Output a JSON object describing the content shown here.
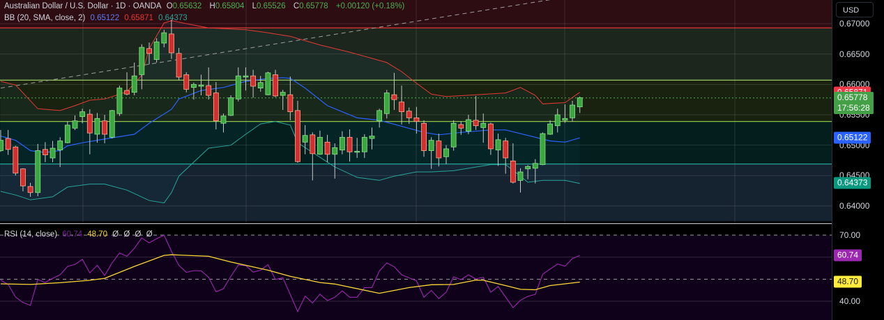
{
  "header": {
    "title": "Australian Dollar / U.S. Dollar · 1D · OANDA",
    "ohlc": [
      {
        "label": "O",
        "value": "0.65632"
      },
      {
        "label": "H",
        "value": "0.65804"
      },
      {
        "label": "L",
        "value": "0.65526"
      },
      {
        "label": "C",
        "value": "0.65778"
      }
    ],
    "change": "+0.00120 (+0.18%)"
  },
  "bb_legend": {
    "name": "BB (20, SMA, close, 2)",
    "basis": "0.65122",
    "upper": "0.65871",
    "lower": "0.64373"
  },
  "rsi_legend": {
    "name": "RSI (14, close)",
    "rsi": "60.74",
    "ma": "48.70",
    "extra": [
      "Ø",
      "Ø",
      "Ø",
      "Ø"
    ]
  },
  "price_axis": {
    "currency": "USD",
    "ticks": [
      "0.67000",
      "0.66500",
      "0.66000",
      "0.65500",
      "0.65000",
      "0.64500",
      "0.64000"
    ],
    "labels": [
      {
        "text": "0.65871",
        "price": 0.65871,
        "color": "#f23645"
      },
      {
        "text": "0.65778",
        "sub": "17:56:28",
        "price": 0.65778,
        "color": "#43a047"
      },
      {
        "text": "0.65122",
        "price": 0.65122,
        "color": "#2962ff"
      },
      {
        "text": "0.64373",
        "price": 0.64373,
        "color": "#089981"
      }
    ]
  },
  "rsi_axis": {
    "ticks": [
      "70.00",
      "40.00"
    ],
    "labels": [
      {
        "text": "60.74",
        "value": 60.74,
        "color": "#9c27b0",
        "fg": "#ffffff"
      },
      {
        "text": "48.70",
        "value": 48.7,
        "color": "#ffeb3b",
        "fg": "#131722"
      }
    ]
  },
  "colors": {
    "up": "#4caf50",
    "down": "#e53935",
    "basis": "#2962ff",
    "upper": "#e53935",
    "lower": "#26a69a",
    "rsi": "#9c27b0",
    "rsi_ma": "#fdd835"
  },
  "chart_data": {
    "type": "candlestick",
    "symbol": "AUDUSD",
    "timeframe": "1D",
    "ylim": [
      0.6375,
      0.6739
    ],
    "ohlc": [
      [
        0.6491,
        0.6525,
        0.6489,
        0.6508
      ],
      [
        0.6511,
        0.6525,
        0.6484,
        0.6493
      ],
      [
        0.6497,
        0.6499,
        0.645,
        0.6454
      ],
      [
        0.6461,
        0.6462,
        0.6424,
        0.6433
      ],
      [
        0.6432,
        0.6438,
        0.6415,
        0.6422
      ],
      [
        0.6422,
        0.6502,
        0.6416,
        0.6491
      ],
      [
        0.6493,
        0.6505,
        0.6472,
        0.6484
      ],
      [
        0.6479,
        0.6507,
        0.6472,
        0.6495
      ],
      [
        0.6492,
        0.6513,
        0.6464,
        0.6507
      ],
      [
        0.6504,
        0.6539,
        0.6503,
        0.6533
      ],
      [
        0.6528,
        0.6549,
        0.6525,
        0.654
      ],
      [
        0.6547,
        0.656,
        0.6536,
        0.6555
      ],
      [
        0.6551,
        0.6559,
        0.6485,
        0.652
      ],
      [
        0.6518,
        0.6553,
        0.6504,
        0.6544
      ],
      [
        0.654,
        0.655,
        0.6503,
        0.6518
      ],
      [
        0.6513,
        0.6558,
        0.6511,
        0.6557
      ],
      [
        0.6552,
        0.6598,
        0.6548,
        0.6594
      ],
      [
        0.659,
        0.662,
        0.6582,
        0.6584
      ],
      [
        0.6587,
        0.6636,
        0.6582,
        0.6614
      ],
      [
        0.6616,
        0.6666,
        0.6592,
        0.6661
      ],
      [
        0.6659,
        0.6669,
        0.6633,
        0.6651
      ],
      [
        0.6641,
        0.6676,
        0.6636,
        0.667
      ],
      [
        0.6668,
        0.669,
        0.6661,
        0.6685
      ],
      [
        0.6683,
        0.6707,
        0.6642,
        0.6652
      ],
      [
        0.6651,
        0.666,
        0.6607,
        0.6612
      ],
      [
        0.6616,
        0.662,
        0.6587,
        0.6592
      ],
      [
        0.6595,
        0.6603,
        0.6575,
        0.66
      ],
      [
        0.6597,
        0.6616,
        0.6582,
        0.6599
      ],
      [
        0.6598,
        0.6628,
        0.6575,
        0.6582
      ],
      [
        0.6586,
        0.6604,
        0.6526,
        0.654
      ],
      [
        0.6536,
        0.6552,
        0.6521,
        0.6548
      ],
      [
        0.6549,
        0.6582,
        0.6548,
        0.6578
      ],
      [
        0.6576,
        0.6628,
        0.6572,
        0.6614
      ],
      [
        0.6612,
        0.6628,
        0.659,
        0.6614
      ],
      [
        0.6614,
        0.6624,
        0.6578,
        0.6597
      ],
      [
        0.6594,
        0.6614,
        0.6588,
        0.6603
      ],
      [
        0.6583,
        0.6621,
        0.6582,
        0.6619
      ],
      [
        0.6616,
        0.6624,
        0.6579,
        0.6581
      ],
      [
        0.6582,
        0.6591,
        0.6558,
        0.6587
      ],
      [
        0.6583,
        0.6613,
        0.6541,
        0.6555
      ],
      [
        0.6557,
        0.6573,
        0.6471,
        0.6473
      ],
      [
        0.6505,
        0.6533,
        0.6485,
        0.6516
      ],
      [
        0.6517,
        0.6521,
        0.6442,
        0.6486
      ],
      [
        0.6485,
        0.6524,
        0.6484,
        0.6513
      ],
      [
        0.6505,
        0.6517,
        0.6472,
        0.6485
      ],
      [
        0.6485,
        0.6503,
        0.6445,
        0.6496
      ],
      [
        0.6492,
        0.6523,
        0.6485,
        0.6513
      ],
      [
        0.6513,
        0.6526,
        0.6473,
        0.6489
      ],
      [
        0.6489,
        0.6512,
        0.6479,
        0.649
      ],
      [
        0.6489,
        0.6518,
        0.6479,
        0.6513
      ],
      [
        0.6511,
        0.6529,
        0.6493,
        0.6515
      ],
      [
        0.654,
        0.656,
        0.6529,
        0.6557
      ],
      [
        0.6552,
        0.6591,
        0.6544,
        0.6586
      ],
      [
        0.6583,
        0.6619,
        0.6558,
        0.6575
      ],
      [
        0.6571,
        0.6598,
        0.6534,
        0.6555
      ],
      [
        0.6556,
        0.6562,
        0.6535,
        0.6545
      ],
      [
        0.6545,
        0.6563,
        0.6519,
        0.6539
      ],
      [
        0.6536,
        0.6541,
        0.6481,
        0.6491
      ],
      [
        0.6491,
        0.6513,
        0.6461,
        0.6508
      ],
      [
        0.6507,
        0.6519,
        0.6465,
        0.6479
      ],
      [
        0.6481,
        0.65,
        0.6469,
        0.6494
      ],
      [
        0.6497,
        0.6541,
        0.6491,
        0.6536
      ],
      [
        0.6534,
        0.6539,
        0.6517,
        0.6528
      ],
      [
        0.6523,
        0.655,
        0.6518,
        0.6542
      ],
      [
        0.6541,
        0.6581,
        0.6525,
        0.6532
      ],
      [
        0.6529,
        0.6552,
        0.6504,
        0.6536
      ],
      [
        0.6535,
        0.6537,
        0.6484,
        0.6494
      ],
      [
        0.6492,
        0.6519,
        0.6466,
        0.6509
      ],
      [
        0.6507,
        0.6512,
        0.6453,
        0.6479
      ],
      [
        0.6474,
        0.6503,
        0.6437,
        0.6439
      ],
      [
        0.6442,
        0.6462,
        0.6422,
        0.6456
      ],
      [
        0.6461,
        0.6467,
        0.6444,
        0.6465
      ],
      [
        0.6462,
        0.6477,
        0.6437,
        0.647
      ],
      [
        0.6468,
        0.6521,
        0.6467,
        0.6519
      ],
      [
        0.6518,
        0.6541,
        0.6517,
        0.6535
      ],
      [
        0.6532,
        0.656,
        0.6521,
        0.655
      ],
      [
        0.6541,
        0.6567,
        0.6537,
        0.6544
      ],
      [
        0.6545,
        0.6573,
        0.6539,
        0.6566
      ],
      [
        0.6563,
        0.658,
        0.6553,
        0.6578
      ]
    ],
    "bb_upper": [
      [
        0,
        0.6605
      ],
      [
        2,
        0.6599
      ],
      [
        5,
        0.656
      ],
      [
        8,
        0.6557
      ],
      [
        10,
        0.6565
      ],
      [
        12,
        0.6574
      ],
      [
        14,
        0.6576
      ],
      [
        17,
        0.6588
      ],
      [
        19,
        0.6615
      ],
      [
        20,
        0.6659
      ],
      [
        22,
        0.6701
      ],
      [
        23,
        0.6705
      ],
      [
        25,
        0.67
      ],
      [
        28,
        0.6693
      ],
      [
        33,
        0.669
      ],
      [
        36,
        0.6685
      ],
      [
        39,
        0.6679
      ],
      [
        43,
        0.6665
      ],
      [
        47,
        0.6653
      ],
      [
        52,
        0.6636
      ],
      [
        54,
        0.6621
      ],
      [
        56,
        0.6602
      ],
      [
        58,
        0.6584
      ],
      [
        60,
        0.658
      ],
      [
        64,
        0.6583
      ],
      [
        68,
        0.6586
      ],
      [
        70,
        0.6595
      ],
      [
        72,
        0.6582
      ],
      [
        73,
        0.6568
      ],
      [
        76,
        0.657
      ],
      [
        78,
        0.6587
      ]
    ],
    "bb_basis": [
      [
        0,
        0.6515
      ],
      [
        2,
        0.6508
      ],
      [
        4,
        0.6491
      ],
      [
        6,
        0.6488
      ],
      [
        8,
        0.6491
      ],
      [
        9,
        0.6499
      ],
      [
        11,
        0.6504
      ],
      [
        14,
        0.651
      ],
      [
        18,
        0.6518
      ],
      [
        20,
        0.6536
      ],
      [
        23,
        0.6559
      ],
      [
        24,
        0.6576
      ],
      [
        27,
        0.659
      ],
      [
        30,
        0.6595
      ],
      [
        33,
        0.6605
      ],
      [
        36,
        0.661
      ],
      [
        38,
        0.6611
      ],
      [
        39,
        0.661
      ],
      [
        41,
        0.6594
      ],
      [
        44,
        0.6565
      ],
      [
        48,
        0.6545
      ],
      [
        51,
        0.6541
      ],
      [
        54,
        0.6531
      ],
      [
        57,
        0.6521
      ],
      [
        59,
        0.6517
      ],
      [
        62,
        0.6521
      ],
      [
        66,
        0.6525
      ],
      [
        68,
        0.6525
      ],
      [
        70,
        0.6519
      ],
      [
        74,
        0.6507
      ],
      [
        76,
        0.6505
      ],
      [
        78,
        0.6512
      ]
    ],
    "bb_lower": [
      [
        0,
        0.6424
      ],
      [
        2,
        0.6418
      ],
      [
        4,
        0.641
      ],
      [
        7,
        0.6415
      ],
      [
        9,
        0.6431
      ],
      [
        12,
        0.6436
      ],
      [
        14,
        0.6436
      ],
      [
        17,
        0.6426
      ],
      [
        20,
        0.6409
      ],
      [
        22,
        0.6405
      ],
      [
        23,
        0.6422
      ],
      [
        24,
        0.6449
      ],
      [
        28,
        0.6495
      ],
      [
        31,
        0.65
      ],
      [
        33,
        0.6518
      ],
      [
        35,
        0.6535
      ],
      [
        37,
        0.6539
      ],
      [
        39,
        0.6533
      ],
      [
        40,
        0.6504
      ],
      [
        45,
        0.6464
      ],
      [
        48,
        0.6447
      ],
      [
        51,
        0.6442
      ],
      [
        53,
        0.6449
      ],
      [
        56,
        0.6456
      ],
      [
        58,
        0.6456
      ],
      [
        61,
        0.6458
      ],
      [
        64,
        0.6464
      ],
      [
        66,
        0.6468
      ],
      [
        68,
        0.6468
      ],
      [
        70,
        0.6449
      ],
      [
        71,
        0.6439
      ],
      [
        73,
        0.6442
      ],
      [
        76,
        0.6442
      ],
      [
        78,
        0.6437
      ]
    ],
    "hlines": [
      {
        "price": 0.6693,
        "color": "#e53935"
      },
      {
        "price": 0.6607,
        "color": "#9ccc65"
      },
      {
        "price": 0.6539,
        "color": "#8bc34a"
      },
      {
        "price": 0.6469,
        "color": "#26a69a"
      }
    ],
    "zones": [
      {
        "from": 0.6739,
        "to": 0.6693,
        "color": "#2d0c12"
      },
      {
        "from": 0.6693,
        "to": 0.6607,
        "color": "#1c261c"
      },
      {
        "from": 0.6607,
        "to": 0.6539,
        "color": "#18220f"
      },
      {
        "from": 0.6539,
        "to": 0.6469,
        "color": "#031e1c"
      },
      {
        "from": 0.6469,
        "to": 0.6375,
        "color": "#15222f"
      }
    ],
    "last_price": 0.65778,
    "trendline": [
      [
        0,
        0.6594
      ],
      [
        86,
        0.6763
      ]
    ],
    "rsi": [
      49.6,
      47.6,
      41.9,
      39.4,
      38.1,
      49.9,
      48.5,
      50.4,
      52.0,
      55.8,
      56.7,
      59.0,
      52.9,
      56.3,
      51.7,
      57.4,
      61.9,
      60.4,
      64.0,
      68.7,
      66.5,
      68.4,
      70.0,
      62.6,
      56.3,
      53.1,
      53.9,
      53.8,
      50.9,
      44.3,
      45.7,
      51.3,
      56.4,
      56.2,
      53.2,
      54.1,
      56.6,
      49.9,
      50.6,
      43.0,
      35.3,
      42.3,
      39.2,
      43.2,
      40.3,
      41.8,
      44.7,
      41.8,
      41.8,
      46.2,
      46.2,
      53.7,
      57.4,
      55.6,
      52.0,
      50.6,
      49.3,
      41.8,
      44.9,
      41.2,
      44.1,
      51.1,
      49.8,
      52.0,
      50.1,
      50.9,
      44.1,
      46.7,
      41.9,
      37.1,
      40.4,
      42.2,
      43.1,
      52.3,
      54.6,
      56.9,
      55.9,
      59.4,
      60.74
    ],
    "rsi_ma": [
      [
        0,
        47.9
      ],
      [
        4,
        47.6
      ],
      [
        8,
        48.4
      ],
      [
        12,
        49.5
      ],
      [
        14,
        50.4
      ],
      [
        18,
        55.8
      ],
      [
        22,
        60.8
      ],
      [
        23,
        61.1
      ],
      [
        28,
        60.4
      ],
      [
        31,
        57.8
      ],
      [
        36,
        54.1
      ],
      [
        39,
        51.3
      ],
      [
        43,
        48.5
      ],
      [
        45,
        47.8
      ],
      [
        51,
        43.6
      ],
      [
        53,
        44.9
      ],
      [
        55,
        46.2
      ],
      [
        58,
        47.5
      ],
      [
        61,
        47.6
      ],
      [
        64,
        49.6
      ],
      [
        65,
        49.5
      ],
      [
        68,
        47.1
      ],
      [
        70,
        45.4
      ],
      [
        72,
        45.2
      ],
      [
        74,
        47.1
      ],
      [
        78,
        48.7
      ]
    ],
    "rsi_levels": {
      "upper": 70,
      "middle": 50,
      "lower": 30
    },
    "rsi_ylim": [
      26,
      75
    ]
  }
}
